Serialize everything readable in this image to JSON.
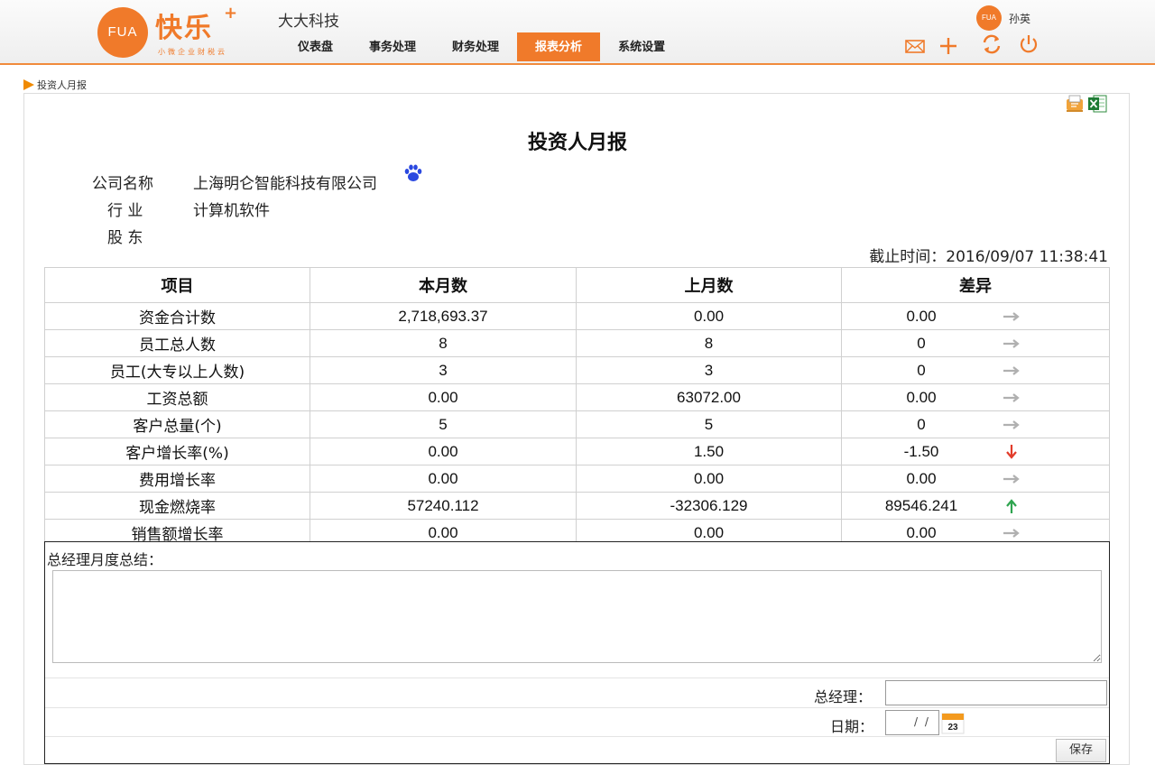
{
  "header": {
    "logo_badge": "FUA",
    "logo_title": "快乐",
    "logo_plus": "+",
    "logo_subtitle": "小微企业财税云",
    "company": "大大科技",
    "nav": [
      {
        "label": "仪表盘",
        "active": false
      },
      {
        "label": "事务处理",
        "active": false
      },
      {
        "label": "财务处理",
        "active": false
      },
      {
        "label": "报表分析",
        "active": true
      },
      {
        "label": "系统设置",
        "active": false
      }
    ],
    "user": {
      "avatar": "FUA",
      "name": "孙英"
    },
    "icons": [
      "mail-icon",
      "plus-icon",
      "refresh-icon",
      "power-icon"
    ]
  },
  "breadcrumb": "投资人月报",
  "report": {
    "title": "投资人月报",
    "company_label": "公司名称",
    "company_value": "上海明仑智能科技有限公司",
    "industry_label": "行 业",
    "industry_value": "计算机软件",
    "shareholder_label": "股 东",
    "deadline": "截止时间：2016/09/07 11:38:41"
  },
  "table": {
    "headers": [
      "项目",
      "本月数",
      "上月数",
      "差异"
    ],
    "rows": [
      {
        "item": "资金合计数",
        "current": "2,718,693.37",
        "previous": "0.00",
        "diff": "0.00",
        "trend": "flat"
      },
      {
        "item": "员工总人数",
        "current": "8",
        "previous": "8",
        "diff": "0",
        "trend": "flat"
      },
      {
        "item": "员工(大专以上人数)",
        "current": "3",
        "previous": "3",
        "diff": "0",
        "trend": "flat"
      },
      {
        "item": "工资总额",
        "current": "0.00",
        "previous": "63072.00",
        "diff": "0.00",
        "trend": "flat"
      },
      {
        "item": "客户总量(个)",
        "current": "5",
        "previous": "5",
        "diff": "0",
        "trend": "flat"
      },
      {
        "item": "客户增长率(%)",
        "current": "0.00",
        "previous": "1.50",
        "diff": "-1.50",
        "trend": "down"
      },
      {
        "item": "费用增长率",
        "current": "0.00",
        "previous": "0.00",
        "diff": "0.00",
        "trend": "flat"
      },
      {
        "item": "现金燃烧率",
        "current": "57240.112",
        "previous": "-32306.129",
        "diff": "89546.241",
        "trend": "up"
      },
      {
        "item": "销售额增长率",
        "current": "0.00",
        "previous": "0.00",
        "diff": "0.00",
        "trend": "flat"
      }
    ]
  },
  "form": {
    "summary_label": "总经理月度总结：",
    "summary_value": "",
    "manager_label": "总经理：",
    "manager_value": "",
    "date_label": "日期：",
    "date_value": "/ /",
    "save_label": "保存"
  },
  "colors": {
    "accent": "#f07a2a",
    "down": "#e23b2a",
    "up": "#2ea44f",
    "flat": "#b0b0b0"
  }
}
